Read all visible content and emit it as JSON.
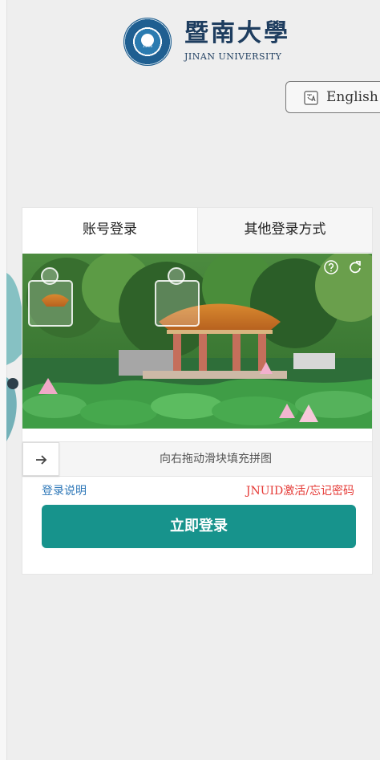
{
  "header": {
    "university_cn": "暨南大學",
    "university_en": "JINAN UNIVERSITY",
    "seal_year": "1906"
  },
  "language_switch": {
    "label": "English",
    "icon": "translate-icon"
  },
  "login": {
    "tabs": [
      {
        "label": "账号登录",
        "active": true
      },
      {
        "label": "其他登录方式",
        "active": false
      }
    ],
    "captcha": {
      "instruction": "向右拖动滑块填充拼图",
      "help_icon": "help-icon",
      "refresh_icon": "refresh-icon",
      "slider_icon": "arrow-right-icon"
    },
    "help_link": "登录说明",
    "reset_link": "JNUID激活/忘记密码",
    "submit": "立即登录"
  },
  "colors": {
    "accent": "#17938c",
    "link_blue": "#2f78b8",
    "link_red": "#e53935",
    "brand_blue": "#1e3d5f"
  }
}
